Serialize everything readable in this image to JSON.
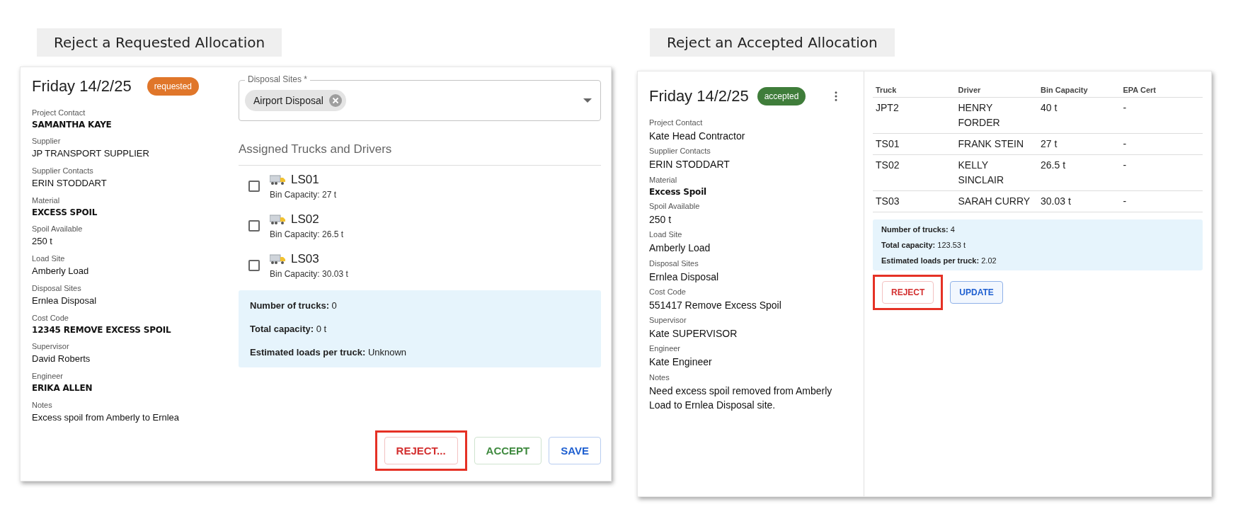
{
  "requested_panel": {
    "heading": "Reject a Requested Allocation",
    "date": "Friday 14/2/25",
    "status": {
      "label": "requested",
      "color": "#e0762a"
    },
    "fields": [
      {
        "label": "Project Contact",
        "value": "SAMANTHA KAYE",
        "strong": true
      },
      {
        "label": "Supplier",
        "value": "JP TRANSPORT SUPPLIER",
        "strong": false
      },
      {
        "label": "Supplier Contacts",
        "value": "ERIN STODDART",
        "strong": false
      },
      {
        "label": "Material",
        "value": "EXCESS SPOIL",
        "strong": true
      },
      {
        "label": "Spoil Available",
        "value": "250 t",
        "strong": false
      },
      {
        "label": "Load Site",
        "value": "Amberly Load",
        "strong": false
      },
      {
        "label": "Disposal Sites",
        "value": "Ernlea Disposal",
        "strong": false
      },
      {
        "label": "Cost Code",
        "value": "12345 REMOVE EXCESS SPOIL",
        "strong": true
      },
      {
        "label": "Supervisor",
        "value": "David Roberts",
        "strong": false
      },
      {
        "label": "Engineer",
        "value": "ERIKA ALLEN",
        "strong": true
      },
      {
        "label": "Notes",
        "value": "Excess spoil from Amberly to Ernlea",
        "strong": false
      }
    ],
    "disposal_field": {
      "label": "Disposal Sites *",
      "chips": [
        "Airport Disposal"
      ]
    },
    "section_title": "Assigned Trucks and Drivers",
    "trucks": [
      {
        "name": "LS01",
        "capacity": "Bin Capacity: 27 t",
        "checked": false
      },
      {
        "name": "LS02",
        "capacity": "Bin Capacity: 26.5 t",
        "checked": false
      },
      {
        "name": "LS03",
        "capacity": "Bin Capacity: 30.03 t",
        "checked": false
      }
    ],
    "summary": [
      {
        "label": "Number of trucks:",
        "value": "0"
      },
      {
        "label": "Total capacity:",
        "value": "0 t"
      },
      {
        "label": "Estimated loads per truck:",
        "value": "Unknown"
      }
    ],
    "buttons": [
      {
        "label": "REJECT...",
        "kind": "reject",
        "highlighted": true
      },
      {
        "label": "ACCEPT",
        "kind": "accept",
        "highlighted": false
      },
      {
        "label": "SAVE",
        "kind": "save",
        "highlighted": false
      }
    ]
  },
  "accepted_panel": {
    "heading": "Reject an Accepted Allocation",
    "date": "Friday 14/2/25",
    "status": {
      "label": "accepted",
      "color": "#3f7d3a"
    },
    "fields": [
      {
        "label": "Project Contact",
        "value": "Kate Head Contractor",
        "strong": false
      },
      {
        "label": "Supplier Contacts",
        "value": "ERIN STODDART",
        "strong": false
      },
      {
        "label": "Material",
        "value": "Excess Spoil",
        "strong": true
      },
      {
        "label": "Spoil Available",
        "value": "250 t",
        "strong": false
      },
      {
        "label": "Load Site",
        "value": "Amberly Load",
        "strong": false
      },
      {
        "label": "Disposal Sites",
        "value": "Ernlea Disposal",
        "strong": false
      },
      {
        "label": "Cost Code",
        "value": "551417 Remove Excess Spoil",
        "strong": false
      },
      {
        "label": "Supervisor",
        "value": "Kate SUPERVISOR",
        "strong": false
      },
      {
        "label": "Engineer",
        "value": "Kate Engineer",
        "strong": false
      },
      {
        "label": "Notes",
        "value": "Need excess spoil removed from Amberly Load to Ernlea Disposal site.",
        "strong": false
      }
    ],
    "table": {
      "columns": [
        "Truck",
        "Driver",
        "Bin Capacity",
        "EPA Cert"
      ],
      "rows": [
        [
          "JPT2",
          "HENRY FORDER",
          "40 t",
          "-"
        ],
        [
          "TS01",
          "FRANK STEIN",
          "27 t",
          "-"
        ],
        [
          "TS02",
          "KELLY SINCLAIR",
          "26.5 t",
          "-"
        ],
        [
          "TS03",
          "SARAH CURRY",
          "30.03 t",
          "-"
        ]
      ]
    },
    "summary": [
      {
        "label": "Number of trucks:",
        "value": "4"
      },
      {
        "label": "Total capacity:",
        "value": "123.53 t"
      },
      {
        "label": "Estimated loads per truck:",
        "value": "2.02"
      }
    ],
    "buttons": [
      {
        "label": "REJECT",
        "kind": "reject",
        "highlighted": true
      },
      {
        "label": "UPDATE",
        "kind": "update",
        "highlighted": false
      }
    ]
  }
}
